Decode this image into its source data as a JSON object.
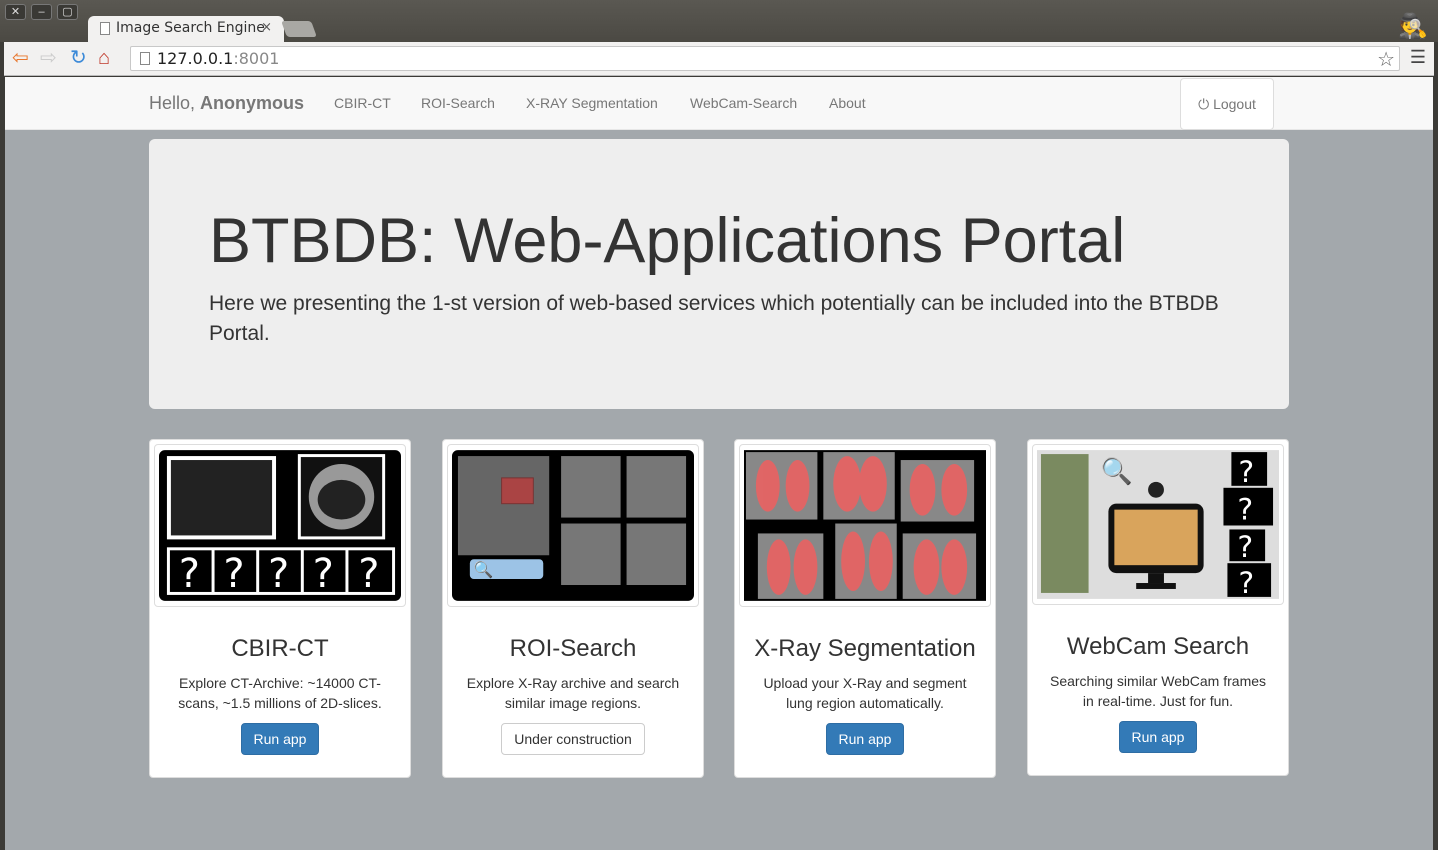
{
  "browser": {
    "tab_title": "Image Search Engine",
    "url_host": "127.0.0.1",
    "url_port": ":8001"
  },
  "navbar": {
    "greeting": "Hello, ",
    "user": "Anonymous",
    "links": [
      "CBIR-CT",
      "ROI-Search",
      "X-RAY Segmentation",
      "WebCam-Search",
      "About"
    ],
    "logout": "Logout"
  },
  "jumbotron": {
    "title": "BTBDB: Web-Applications Portal",
    "text": "Here we presenting the 1-st version of web-based services which potentially can be included into the BTBDB Portal."
  },
  "cards": [
    {
      "title": "CBIR-CT",
      "text": "Explore CT-Archive: ~14000 CT-scans, ~1.5 millions of 2D-slices.",
      "button": "Run app"
    },
    {
      "title": "ROI-Search",
      "text": "Explore X-Ray archive and search similar image regions.",
      "button": "Under construction"
    },
    {
      "title": "X-Ray Segmentation",
      "text": "Upload your X-Ray and segment lung region automatically.",
      "button": "Run app"
    },
    {
      "title": "WebCam Search",
      "text": "Searching similar WebCam frames in real-time. Just for fun.",
      "button": "Run app"
    }
  ],
  "colors": {
    "primary": "#337ab7",
    "background": "#a3a8ac",
    "jumbotron": "#eeeeee"
  }
}
